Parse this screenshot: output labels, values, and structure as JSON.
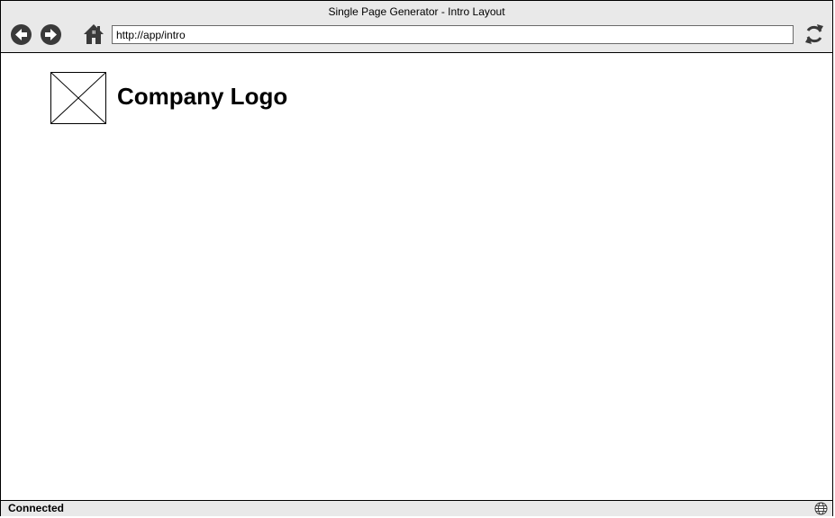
{
  "window": {
    "title": "Single Page Generator - Intro Layout"
  },
  "toolbar": {
    "back_icon": "back-arrow-icon",
    "forward_icon": "forward-arrow-icon",
    "home_icon": "home-icon",
    "refresh_icon": "refresh-icon",
    "address": "http://app/intro"
  },
  "content": {
    "logo_image_icon": "image-placeholder-icon",
    "logo_text": "Company Logo"
  },
  "statusbar": {
    "status": "Connected",
    "globe_icon": "globe-icon"
  },
  "colors": {
    "chrome": "#e9e9e9",
    "icon": "#3a3a3a",
    "border": "#000000"
  }
}
